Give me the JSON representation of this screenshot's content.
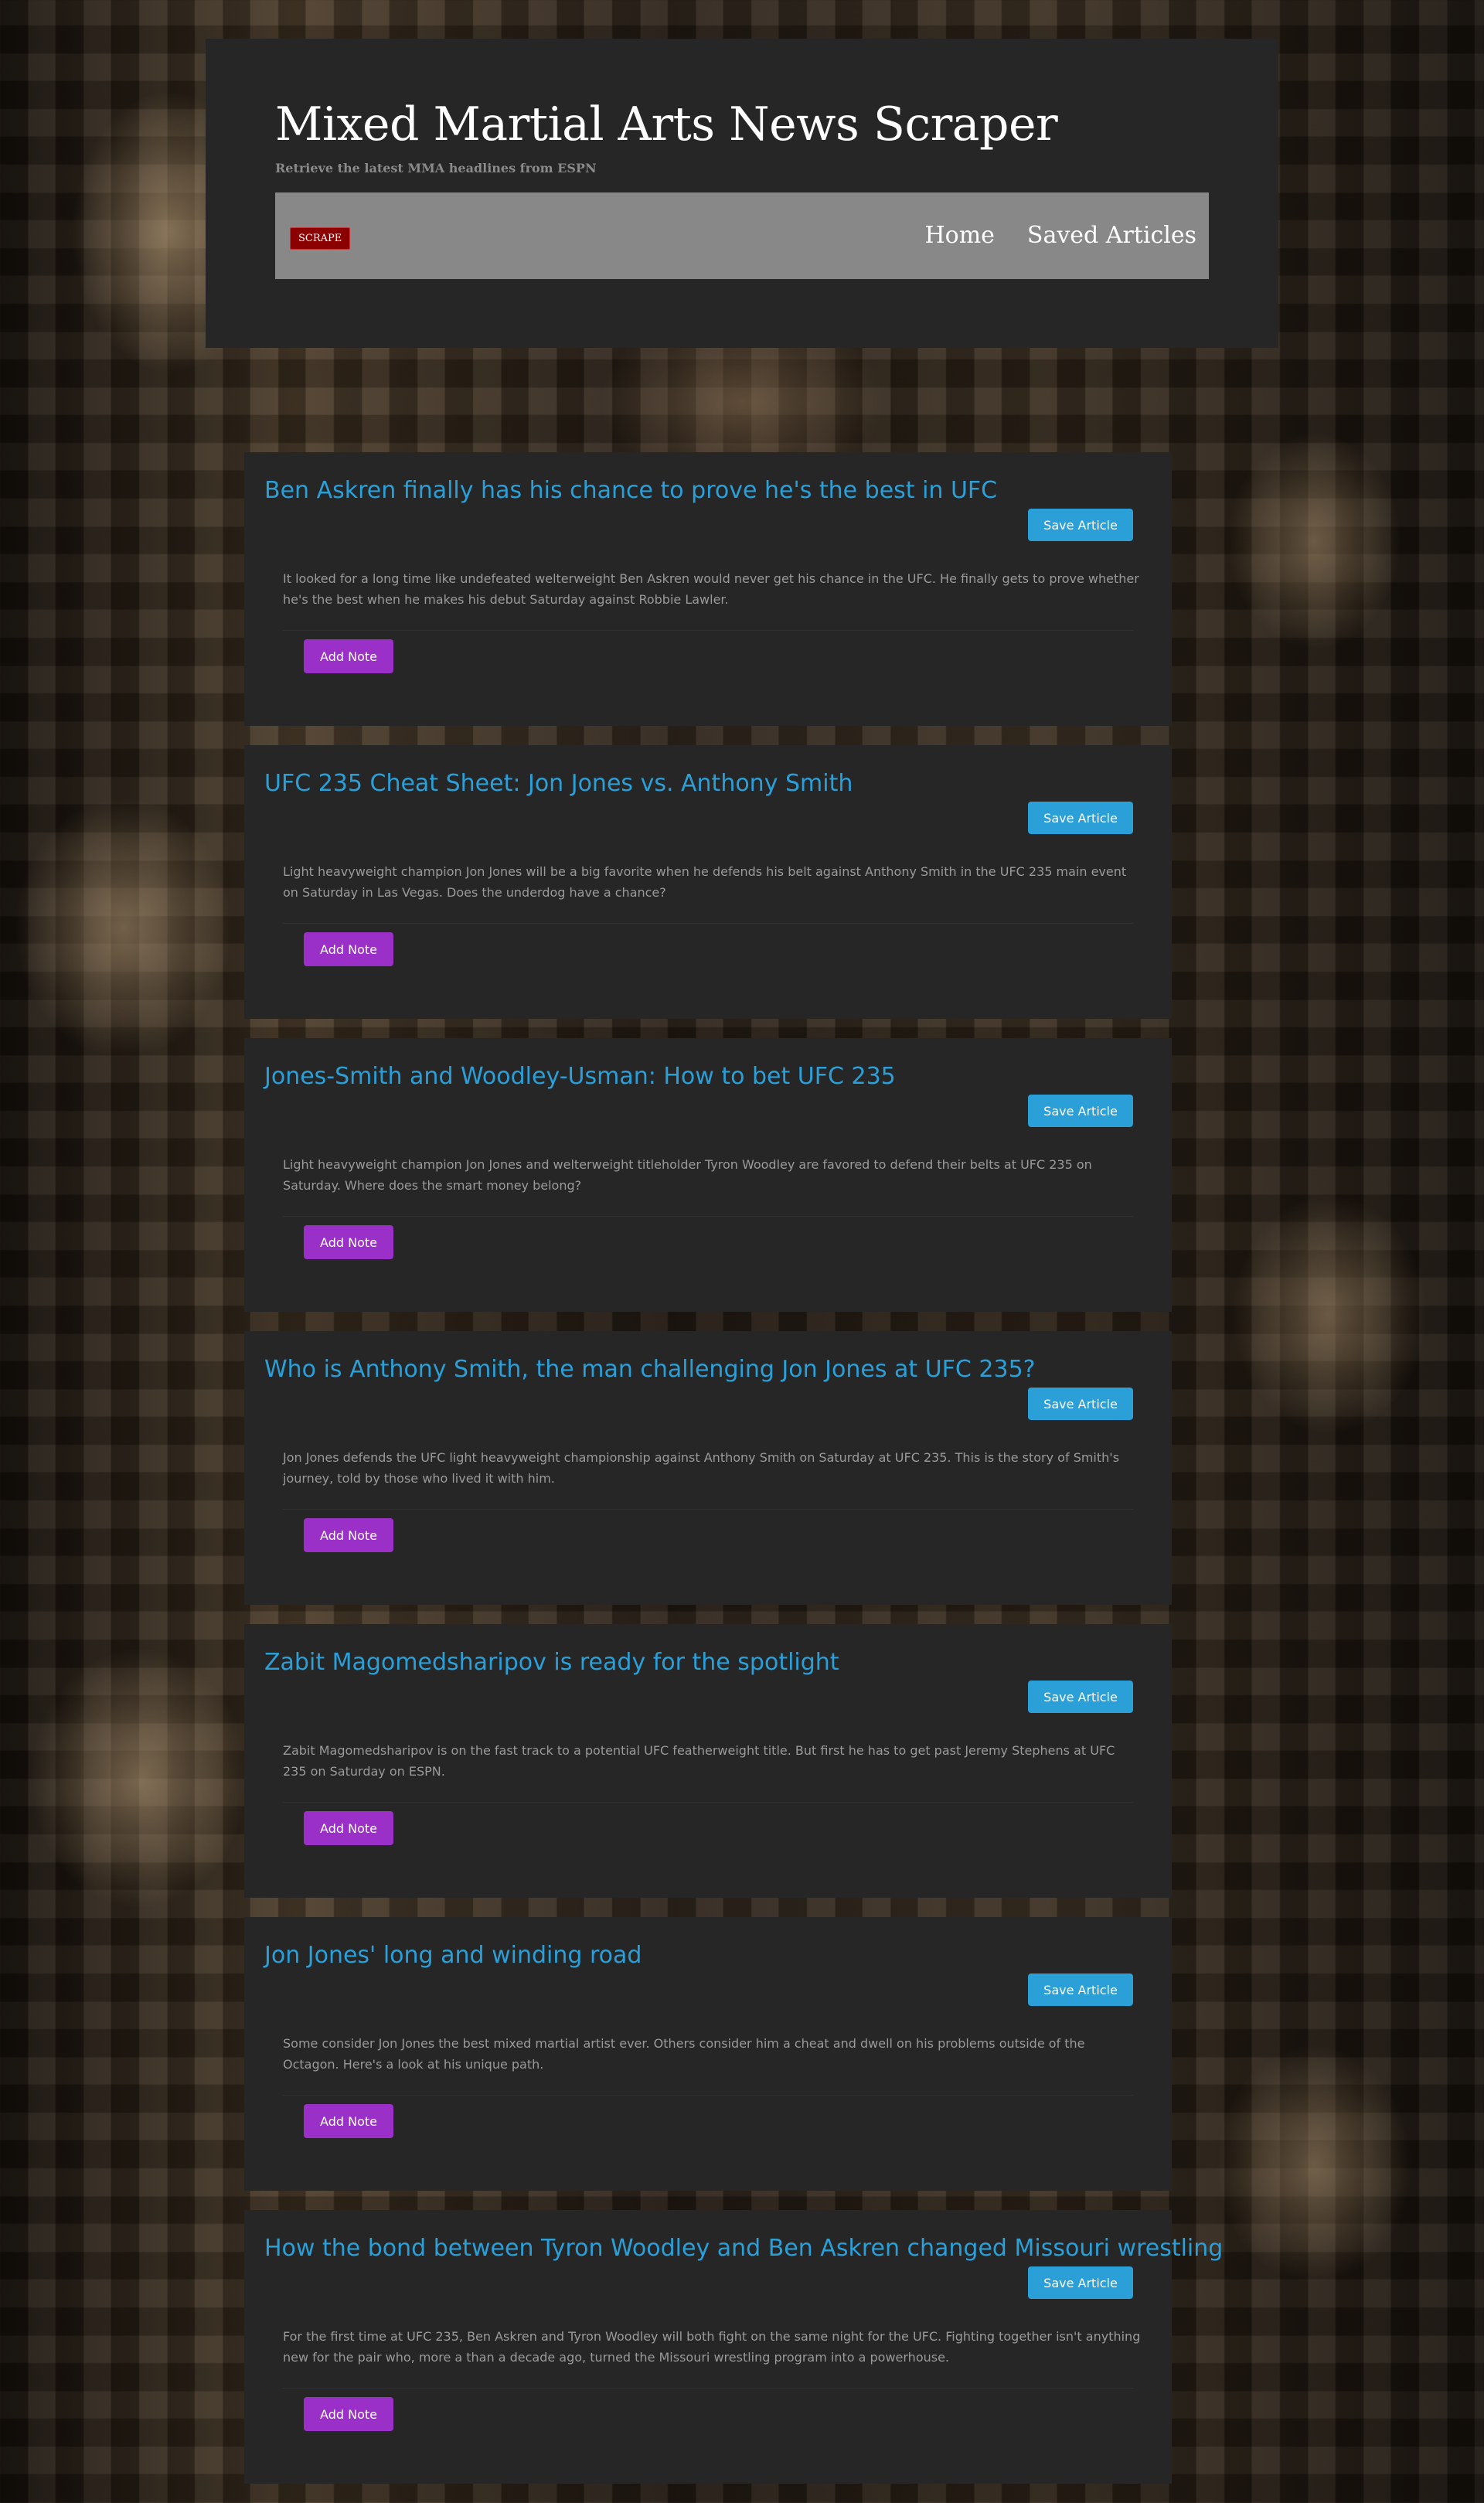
{
  "header": {
    "title": "Mixed Martial Arts News Scraper",
    "subtitle": "Retrieve the latest MMA headlines from ESPN",
    "scrape_label": "SCRAPE",
    "nav": {
      "home": "Home",
      "saved": "Saved Articles"
    }
  },
  "buttons": {
    "save": "Save Article",
    "note": "Add Note"
  },
  "articles": [
    {
      "title": "Ben Askren finally has his chance to prove he's the best in UFC",
      "summary": "It looked for a long time like undefeated welterweight Ben Askren would never get his chance in the UFC. He finally gets to prove whether he's the best when he makes his debut Saturday against Robbie Lawler."
    },
    {
      "title": "UFC 235 Cheat Sheet: Jon Jones vs. Anthony Smith",
      "summary": "Light heavyweight champion Jon Jones will be a big favorite when he defends his belt against Anthony Smith in the UFC 235 main event on Saturday in Las Vegas. Does the underdog have a chance?"
    },
    {
      "title": "Jones-Smith and Woodley-Usman: How to bet UFC 235",
      "summary": "Light heavyweight champion Jon Jones and welterweight titleholder Tyron Woodley are favored to defend their belts at UFC 235 on Saturday. Where does the smart money belong?"
    },
    {
      "title": "Who is Anthony Smith, the man challenging Jon Jones at UFC 235?",
      "summary": "Jon Jones defends the UFC light heavyweight championship against Anthony Smith on Saturday at UFC 235. This is the story of Smith's journey, told by those who lived it with him."
    },
    {
      "title": "Zabit Magomedsharipov is ready for the spotlight",
      "summary": "Zabit Magomedsharipov is on the fast track to a potential UFC featherweight title. But first he has to get past Jeremy Stephens at UFC 235 on Saturday on ESPN."
    },
    {
      "title": "Jon Jones' long and winding road",
      "summary": "Some consider Jon Jones the best mixed martial artist ever. Others consider him a cheat and dwell on his problems outside of the Octagon. Here's a look at his unique path."
    },
    {
      "title": "How the bond between Tyron Woodley and Ben Askren changed Missouri wrestling",
      "summary": "For the first time at UFC 235, Ben Askren and Tyron Woodley will both fight on the same night for the UFC. Fighting together isn't anything new for the pair who, more a than a decade ago, turned the Missouri wrestling program into a powerhouse."
    }
  ]
}
